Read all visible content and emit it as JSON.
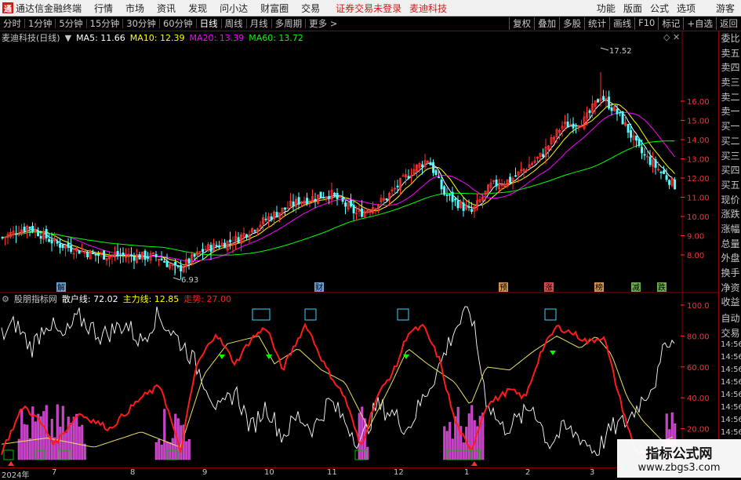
{
  "menubar": {
    "logo": "通",
    "app_name": "通达信金融终端",
    "items": [
      "行情",
      "市场",
      "资讯",
      "发现",
      "问小达",
      "财富圈",
      "交易"
    ],
    "status": "证券交易未登录",
    "stock": "麦迪科技",
    "right_items": [
      "功能",
      "版面",
      "公式",
      "选项"
    ],
    "guest": "游客"
  },
  "toolbar": {
    "periods": [
      "分时",
      "1分钟",
      "5分钟",
      "15分钟",
      "30分钟",
      "60分钟",
      "日线",
      "周线",
      "月线",
      "多周期",
      "更多 >"
    ],
    "active": "日线",
    "right_buttons": [
      "复权",
      "叠加",
      "多股",
      "统计",
      "画线",
      "F10",
      "标记",
      "+自选",
      "返回"
    ]
  },
  "price_panel": {
    "title": "麦迪科技(日线)",
    "ma": [
      {
        "label": "MA5: 11.66",
        "color": "#ffffff"
      },
      {
        "label": "MA10: 12.39",
        "color": "#ffff00"
      },
      {
        "label": "MA20: 13.39",
        "color": "#ff00ff"
      },
      {
        "label": "MA60: 13.72",
        "color": "#00ff00"
      }
    ],
    "y_ticks": [
      "16.00",
      "15.00",
      "14.00",
      "13.00",
      "12.00",
      "11.00",
      "10.00",
      "9.00",
      "8.00"
    ],
    "high_label": "17.52",
    "low_label": "6.93",
    "markers": [
      "解",
      "财",
      "预",
      "涨",
      "榜",
      "减",
      "跌"
    ]
  },
  "indicator_panel": {
    "title": "股朋指标网",
    "retail": "散户线: 72.02",
    "main": "主力线: 12.85",
    "trend": "走势: 27.00",
    "y_ticks": [
      "100.0",
      "80.00",
      "60.00",
      "40.00",
      "20.00"
    ]
  },
  "right_panel": {
    "items": [
      "委比",
      "卖五",
      "卖四",
      "卖三",
      "卖二",
      "卖一",
      "买一",
      "买二",
      "买三",
      "买四",
      "买五",
      "现价",
      "涨跌",
      "涨幅",
      "总量",
      "外盘",
      "换手",
      "净资",
      "收益"
    ],
    "lower": [
      "自动",
      "交易"
    ],
    "times": [
      "14:56",
      "14:56",
      "14:56",
      "14:56",
      "14:56",
      "14:56",
      "14:56",
      "14:56"
    ]
  },
  "x_axis": [
    "2024年",
    "7",
    "8",
    "9",
    "10",
    "11",
    "12",
    "1",
    "2",
    "3"
  ],
  "watermark": {
    "line1": "指标公式网",
    "line2": "www.zbgs3.com"
  },
  "chart_data": {
    "type": "candlestick",
    "y_range": [
      6.5,
      18.0
    ],
    "start": 8.8,
    "end": 11.6,
    "high": 17.52,
    "low": 6.93
  }
}
